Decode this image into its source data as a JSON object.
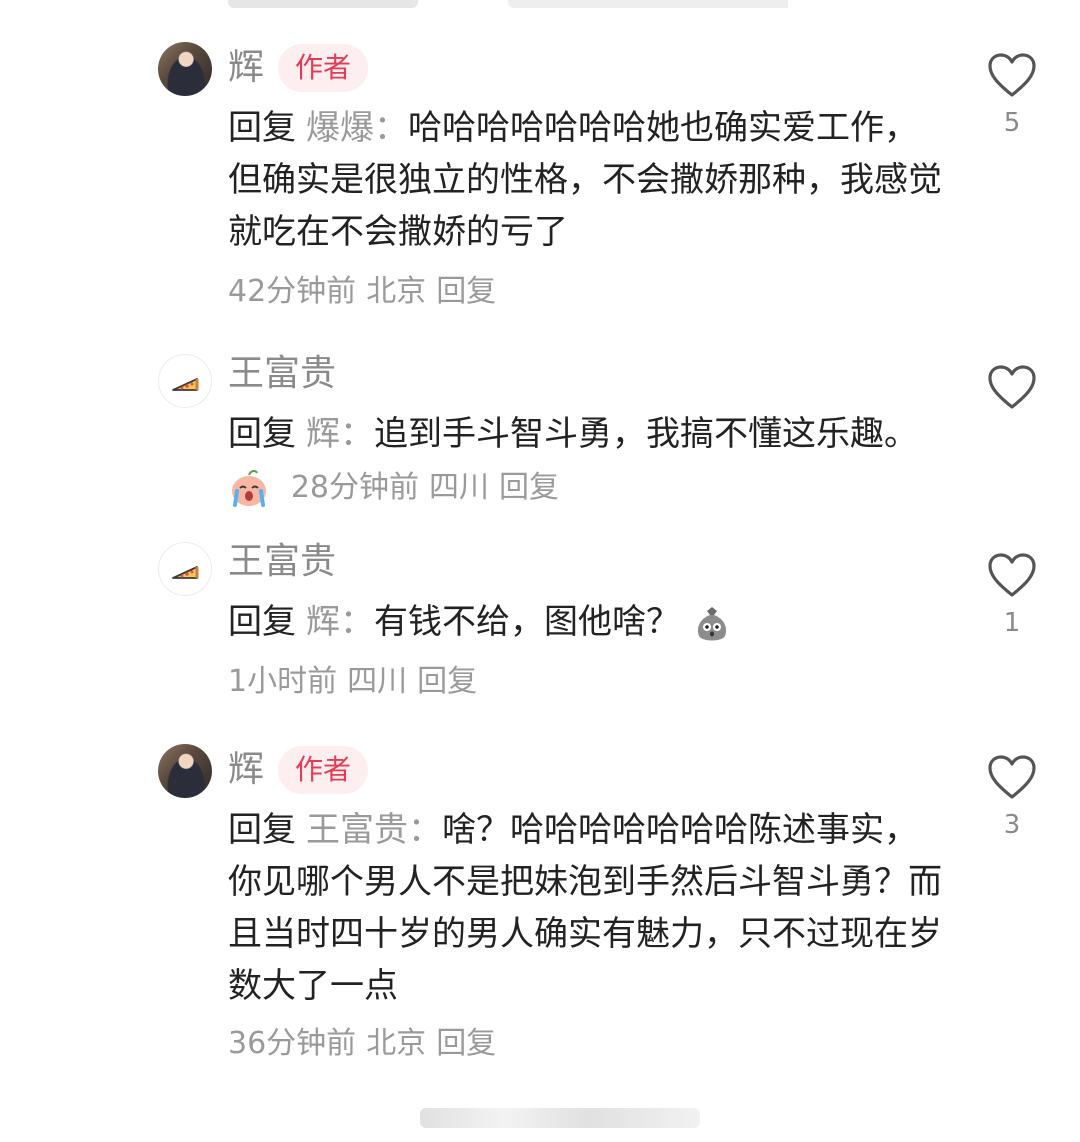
{
  "comments": [
    {
      "name": "辉",
      "badge": "作者",
      "reply_label": "回复",
      "reply_to": "爆爆：",
      "text": "哈哈哈哈哈哈哈她也确实爱工作，但确实是很独立的性格，不会撒娇那种，我感觉就吃在不会撒娇的亏了",
      "time": "42分钟前",
      "location": "北京",
      "reply_action": "回复",
      "likes": "5",
      "avatar": "photo-avatar"
    },
    {
      "name": "王富贵",
      "reply_label": "回复",
      "reply_to": "辉：",
      "text": "追到手斗智斗勇，我搞不懂这乐趣。",
      "emoji": "crying-face-emoji",
      "time": "28分钟前",
      "location": "四川",
      "reply_action": "回复",
      "likes": "",
      "avatar": "pizza-icon"
    },
    {
      "name": "王富贵",
      "reply_label": "回复",
      "reply_to": "辉：",
      "text": "有钱不给，图他啥？",
      "emoji": "money-bag-face-emoji",
      "time": "1小时前",
      "location": "四川",
      "reply_action": "回复",
      "likes": "1",
      "avatar": "pizza-icon"
    },
    {
      "name": "辉",
      "badge": "作者",
      "reply_label": "回复",
      "reply_to": "王富贵：",
      "text": "啥？哈哈哈哈哈哈哈陈述事实，你见哪个男人不是把妹泡到手然后斗智斗勇？而且当时四十岁的男人确实有魅力，只不过现在岁数大了一点",
      "time": "36分钟前",
      "location": "北京",
      "reply_action": "回复",
      "likes": "3",
      "avatar": "photo-avatar"
    }
  ],
  "colors": {
    "badge_bg": "#fdeef0",
    "badge_text": "#e83a52",
    "secondary_text": "#9a9a9a",
    "primary_text": "#222222"
  }
}
